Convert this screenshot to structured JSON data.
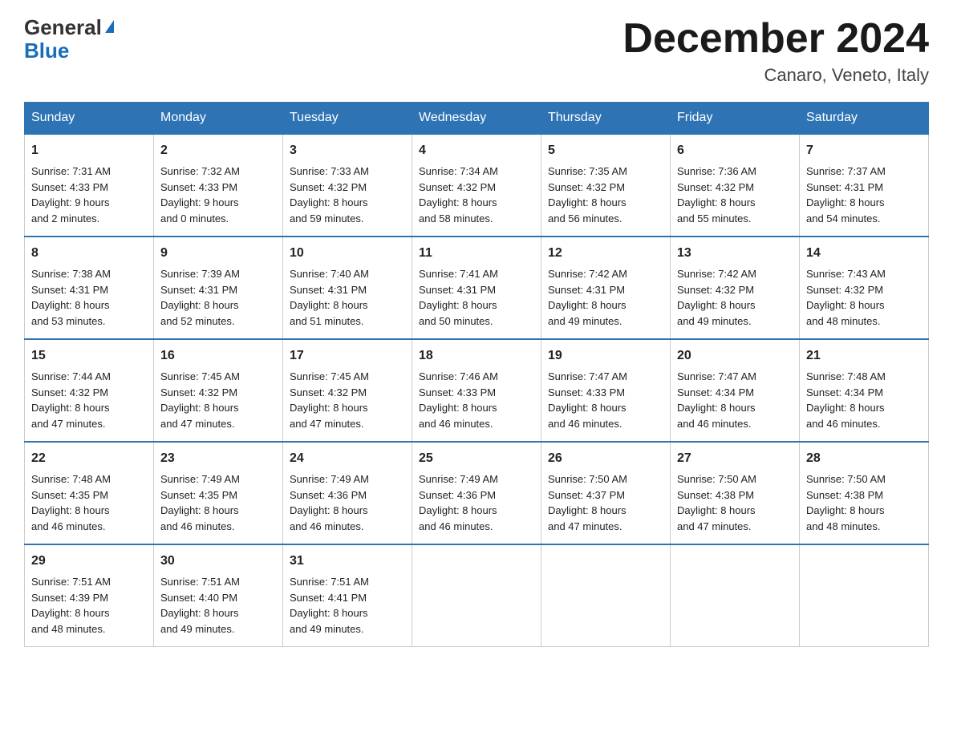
{
  "logo": {
    "general": "General",
    "blue": "Blue",
    "triangle": "▶"
  },
  "title": "December 2024",
  "location": "Canaro, Veneto, Italy",
  "days_of_week": [
    "Sunday",
    "Monday",
    "Tuesday",
    "Wednesday",
    "Thursday",
    "Friday",
    "Saturday"
  ],
  "weeks": [
    [
      {
        "day": "1",
        "sunrise": "7:31 AM",
        "sunset": "4:33 PM",
        "daylight": "9 hours and 2 minutes."
      },
      {
        "day": "2",
        "sunrise": "7:32 AM",
        "sunset": "4:33 PM",
        "daylight": "9 hours and 0 minutes."
      },
      {
        "day": "3",
        "sunrise": "7:33 AM",
        "sunset": "4:32 PM",
        "daylight": "8 hours and 59 minutes."
      },
      {
        "day": "4",
        "sunrise": "7:34 AM",
        "sunset": "4:32 PM",
        "daylight": "8 hours and 58 minutes."
      },
      {
        "day": "5",
        "sunrise": "7:35 AM",
        "sunset": "4:32 PM",
        "daylight": "8 hours and 56 minutes."
      },
      {
        "day": "6",
        "sunrise": "7:36 AM",
        "sunset": "4:32 PM",
        "daylight": "8 hours and 55 minutes."
      },
      {
        "day": "7",
        "sunrise": "7:37 AM",
        "sunset": "4:31 PM",
        "daylight": "8 hours and 54 minutes."
      }
    ],
    [
      {
        "day": "8",
        "sunrise": "7:38 AM",
        "sunset": "4:31 PM",
        "daylight": "8 hours and 53 minutes."
      },
      {
        "day": "9",
        "sunrise": "7:39 AM",
        "sunset": "4:31 PM",
        "daylight": "8 hours and 52 minutes."
      },
      {
        "day": "10",
        "sunrise": "7:40 AM",
        "sunset": "4:31 PM",
        "daylight": "8 hours and 51 minutes."
      },
      {
        "day": "11",
        "sunrise": "7:41 AM",
        "sunset": "4:31 PM",
        "daylight": "8 hours and 50 minutes."
      },
      {
        "day": "12",
        "sunrise": "7:42 AM",
        "sunset": "4:31 PM",
        "daylight": "8 hours and 49 minutes."
      },
      {
        "day": "13",
        "sunrise": "7:42 AM",
        "sunset": "4:32 PM",
        "daylight": "8 hours and 49 minutes."
      },
      {
        "day": "14",
        "sunrise": "7:43 AM",
        "sunset": "4:32 PM",
        "daylight": "8 hours and 48 minutes."
      }
    ],
    [
      {
        "day": "15",
        "sunrise": "7:44 AM",
        "sunset": "4:32 PM",
        "daylight": "8 hours and 47 minutes."
      },
      {
        "day": "16",
        "sunrise": "7:45 AM",
        "sunset": "4:32 PM",
        "daylight": "8 hours and 47 minutes."
      },
      {
        "day": "17",
        "sunrise": "7:45 AM",
        "sunset": "4:32 PM",
        "daylight": "8 hours and 47 minutes."
      },
      {
        "day": "18",
        "sunrise": "7:46 AM",
        "sunset": "4:33 PM",
        "daylight": "8 hours and 46 minutes."
      },
      {
        "day": "19",
        "sunrise": "7:47 AM",
        "sunset": "4:33 PM",
        "daylight": "8 hours and 46 minutes."
      },
      {
        "day": "20",
        "sunrise": "7:47 AM",
        "sunset": "4:34 PM",
        "daylight": "8 hours and 46 minutes."
      },
      {
        "day": "21",
        "sunrise": "7:48 AM",
        "sunset": "4:34 PM",
        "daylight": "8 hours and 46 minutes."
      }
    ],
    [
      {
        "day": "22",
        "sunrise": "7:48 AM",
        "sunset": "4:35 PM",
        "daylight": "8 hours and 46 minutes."
      },
      {
        "day": "23",
        "sunrise": "7:49 AM",
        "sunset": "4:35 PM",
        "daylight": "8 hours and 46 minutes."
      },
      {
        "day": "24",
        "sunrise": "7:49 AM",
        "sunset": "4:36 PM",
        "daylight": "8 hours and 46 minutes."
      },
      {
        "day": "25",
        "sunrise": "7:49 AM",
        "sunset": "4:36 PM",
        "daylight": "8 hours and 46 minutes."
      },
      {
        "day": "26",
        "sunrise": "7:50 AM",
        "sunset": "4:37 PM",
        "daylight": "8 hours and 47 minutes."
      },
      {
        "day": "27",
        "sunrise": "7:50 AM",
        "sunset": "4:38 PM",
        "daylight": "8 hours and 47 minutes."
      },
      {
        "day": "28",
        "sunrise": "7:50 AM",
        "sunset": "4:38 PM",
        "daylight": "8 hours and 48 minutes."
      }
    ],
    [
      {
        "day": "29",
        "sunrise": "7:51 AM",
        "sunset": "4:39 PM",
        "daylight": "8 hours and 48 minutes."
      },
      {
        "day": "30",
        "sunrise": "7:51 AM",
        "sunset": "4:40 PM",
        "daylight": "8 hours and 49 minutes."
      },
      {
        "day": "31",
        "sunrise": "7:51 AM",
        "sunset": "4:41 PM",
        "daylight": "8 hours and 49 minutes."
      },
      null,
      null,
      null,
      null
    ]
  ]
}
